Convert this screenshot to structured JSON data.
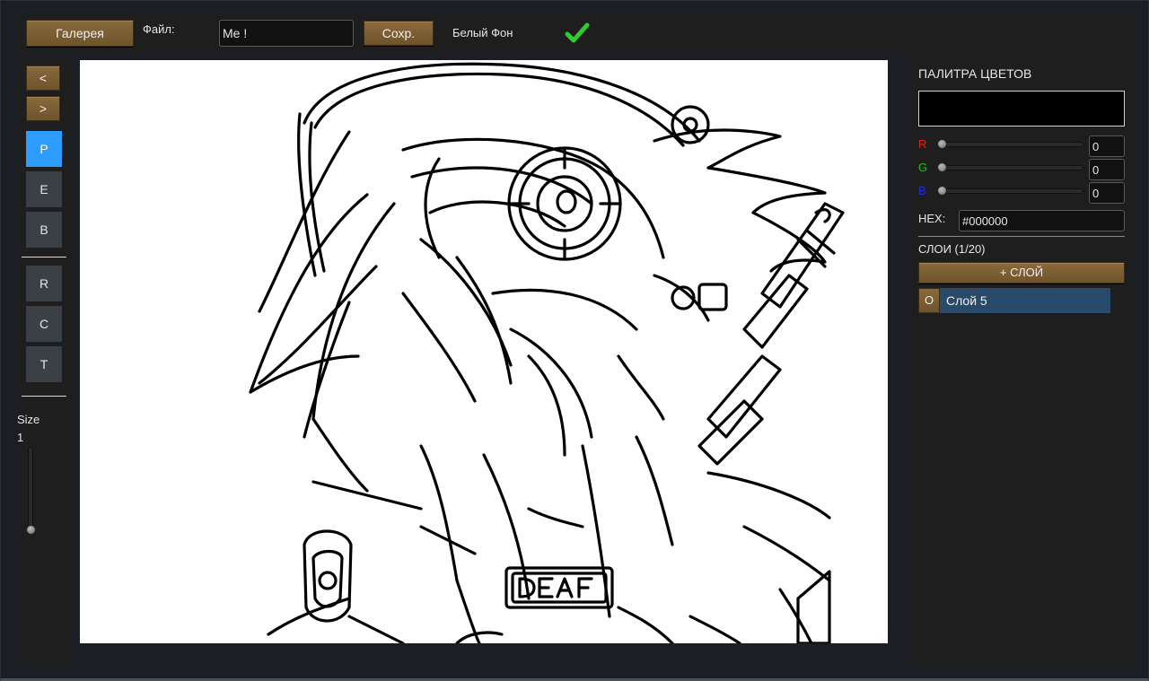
{
  "toolbar": {
    "gallery_label": "Галерея",
    "file_label": "Файл:",
    "file_value": "Me !",
    "save_label": "Сохр.",
    "background_label": "Белый Фон",
    "background_checked": true,
    "check_color": "#2ecc2e"
  },
  "tools": {
    "prev_label": "<",
    "next_label": ">",
    "items": [
      {
        "label": "P",
        "active": true
      },
      {
        "label": "E",
        "active": false
      },
      {
        "label": "B",
        "active": false
      },
      {
        "label": "R",
        "active": false
      },
      {
        "label": "C",
        "active": false
      },
      {
        "label": "T",
        "active": false
      }
    ],
    "size_label": "Size",
    "size_value": "1",
    "active_color": "#2e9bff"
  },
  "palette": {
    "title": "ПАЛИТРА ЦВЕТОВ",
    "preview_color": "#000000",
    "channels": [
      {
        "label": "R",
        "value": "0",
        "color": "#e02020"
      },
      {
        "label": "G",
        "value": "0",
        "color": "#20c020"
      },
      {
        "label": "B",
        "value": "0",
        "color": "#2030e0"
      }
    ],
    "hex_label": "HEX:",
    "hex_value": "#000000"
  },
  "layers": {
    "title": "СЛОИ (1/20)",
    "add_label": "+ СЛОЙ",
    "items": [
      {
        "visibility_label": "O",
        "name": "Слой 5",
        "selected": true
      }
    ]
  },
  "colors": {
    "accent_gold": "#7c5e34",
    "selected_layer": "#2a4a6a"
  }
}
